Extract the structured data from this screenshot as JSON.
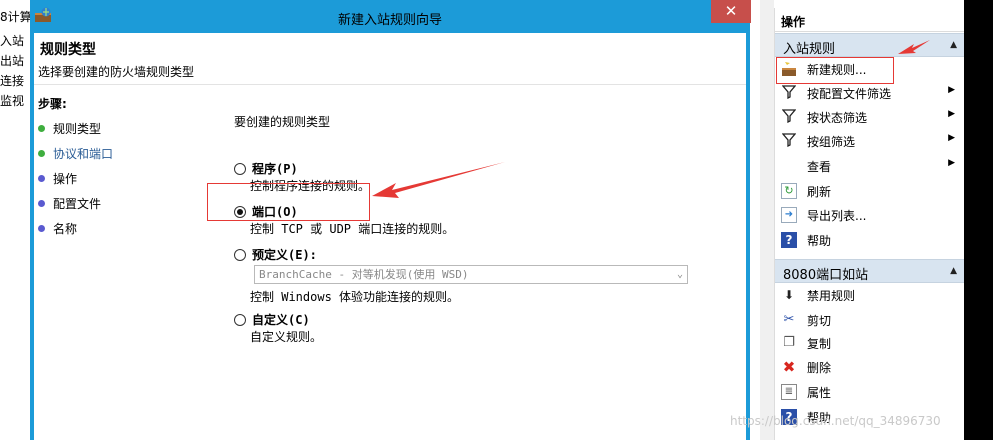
{
  "background_tree": [
    "8计算",
    "入站",
    "出站",
    "连接",
    "监视"
  ],
  "dialog": {
    "title": "新建入站规则向导",
    "close_label": "✕",
    "header_title": "规则类型",
    "header_subtitle": "选择要创建的防火墙规则类型",
    "steps_label": "步骤:",
    "steps": [
      {
        "label": "规则类型",
        "status": "done"
      },
      {
        "label": "协议和端口",
        "status": "current"
      },
      {
        "label": "操作",
        "status": "pending"
      },
      {
        "label": "配置文件",
        "status": "pending"
      },
      {
        "label": "名称",
        "status": "pending"
      }
    ],
    "prompt": "要创建的规则类型",
    "options": [
      {
        "label": "程序(P)",
        "desc": "控制程序连接的规则。",
        "checked": false
      },
      {
        "label": "端口(O)",
        "desc": "控制 TCP 或 UDP 端口连接的规则。",
        "checked": true
      },
      {
        "label": "预定义(E):",
        "desc": "控制 Windows 体验功能连接的规则。",
        "checked": false,
        "select_value": "BranchCache - 对等机发现(使用 WSD)"
      },
      {
        "label": "自定义(C)",
        "desc": "自定义规则。",
        "checked": false
      }
    ]
  },
  "actions": {
    "header": "操作",
    "section1": {
      "title": "入站规则",
      "items": [
        {
          "label": "新建规则...",
          "icon": "new-rule-icon",
          "submenu": false
        },
        {
          "label": "按配置文件筛选",
          "icon": "filter-icon",
          "submenu": true
        },
        {
          "label": "按状态筛选",
          "icon": "filter-icon",
          "submenu": true
        },
        {
          "label": "按组筛选",
          "icon": "filter-icon",
          "submenu": true
        },
        {
          "label": "查看",
          "icon": "",
          "submenu": true
        },
        {
          "label": "刷新",
          "icon": "refresh-icon",
          "submenu": false
        },
        {
          "label": "导出列表...",
          "icon": "export-icon",
          "submenu": false
        },
        {
          "label": "帮助",
          "icon": "help-icon",
          "submenu": false
        }
      ]
    },
    "section2": {
      "title": "8080端口如站",
      "items": [
        {
          "label": "禁用规则",
          "icon": "disable-icon"
        },
        {
          "label": "剪切",
          "icon": "cut-icon"
        },
        {
          "label": "复制",
          "icon": "copy-icon"
        },
        {
          "label": "删除",
          "icon": "delete-icon"
        },
        {
          "label": "属性",
          "icon": "properties-icon"
        },
        {
          "label": "帮助",
          "icon": "help-icon"
        }
      ]
    }
  },
  "watermark": "https://blog.csdn.net/qq_34896730",
  "colors": {
    "titlebar": "#1c9bd8",
    "close": "#c74f4b",
    "annotation": "#e53935",
    "section": "#d8e4f0"
  }
}
